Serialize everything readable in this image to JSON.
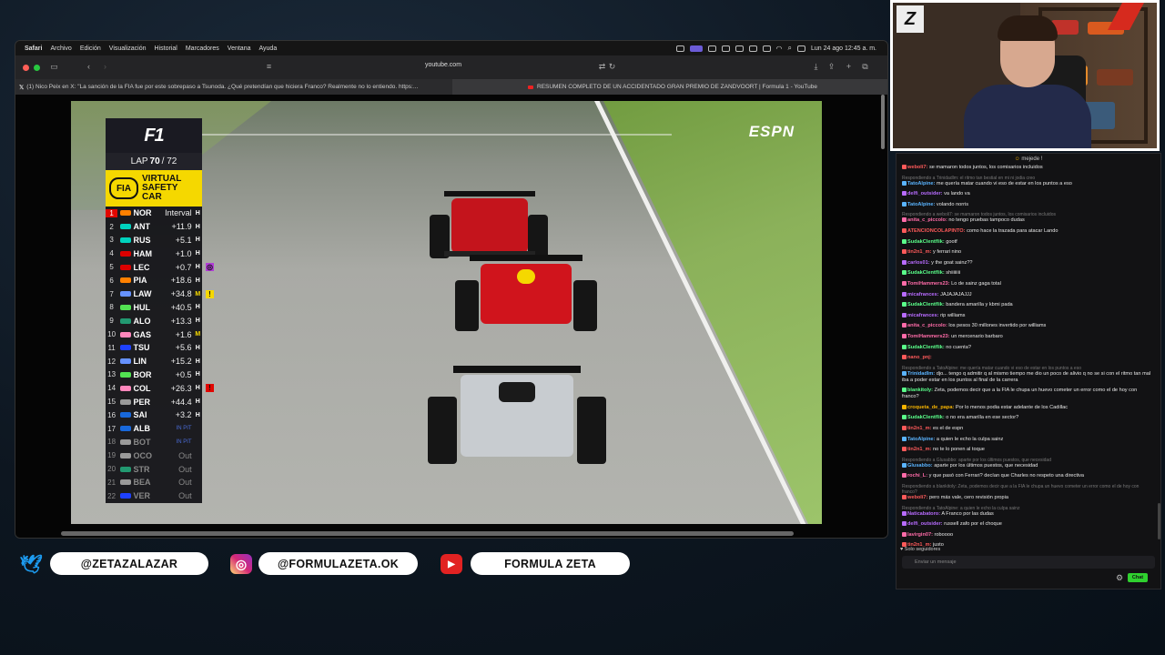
{
  "menubar": {
    "items": [
      "Safari",
      "Archivo",
      "Edición",
      "Visualización",
      "Historial",
      "Marcadores",
      "Ventana",
      "Ayuda"
    ],
    "datetime": "Lun 24 ago 12:45 a. m."
  },
  "toolbar": {
    "url": "youtube.com"
  },
  "tabs": [
    {
      "label": "(1) Nico Peix en X: \"La sanción de la FIA fue por este sobrepaso a Tsunoda. ¿Qué pretendían que hiciera Franco? Realmente no lo entiendo. https:..."
    },
    {
      "label": "RESUMEN COMPLETO DE UN ACCIDENTADO GRAN PREMIO DE ZANDVOORT | Formula 1 - YouTube"
    }
  ],
  "video": {
    "broadcaster": "ESPN",
    "tower": {
      "lap_label": "LAP",
      "lap_current": "70",
      "lap_total": "/ 72",
      "fia": "FIA",
      "vsc_line1": "VIRTUAL",
      "vsc_line2": "SAFETY",
      "vsc_line3": "CAR",
      "rows": [
        {
          "pos": "1",
          "driver": "NOR",
          "gap": "Interval",
          "tyre": "H",
          "tyre_color": "#ffffff",
          "team_color": "#ff8000"
        },
        {
          "pos": "2",
          "driver": "ANT",
          "gap": "+11.9",
          "tyre": "H",
          "tyre_color": "#ffffff",
          "team_color": "#00d2be"
        },
        {
          "pos": "3",
          "driver": "RUS",
          "gap": "+5.1",
          "tyre": "H",
          "tyre_color": "#ffffff",
          "team_color": "#00d2be"
        },
        {
          "pos": "4",
          "driver": "HAM",
          "gap": "+1.0",
          "tyre": "H",
          "tyre_color": "#ffffff",
          "team_color": "#dc0000"
        },
        {
          "pos": "5",
          "driver": "LEC",
          "gap": "+0.7",
          "tyre": "H",
          "tyre_color": "#ffffff",
          "team_color": "#dc0000",
          "flag": "◎",
          "flag_color": "#b13cd6"
        },
        {
          "pos": "6",
          "driver": "PIA",
          "gap": "+18.6",
          "tyre": "H",
          "tyre_color": "#ffffff",
          "team_color": "#ff8000"
        },
        {
          "pos": "7",
          "driver": "LAW",
          "gap": "+34.8",
          "tyre": "M",
          "tyre_color": "#f5d800",
          "team_color": "#6692ff",
          "flag": "!",
          "flag_color": "#f5d800"
        },
        {
          "pos": "8",
          "driver": "HUL",
          "gap": "+40.5",
          "tyre": "H",
          "tyre_color": "#ffffff",
          "team_color": "#52e252"
        },
        {
          "pos": "9",
          "driver": "ALO",
          "gap": "+13.3",
          "tyre": "H",
          "tyre_color": "#ffffff",
          "team_color": "#229971"
        },
        {
          "pos": "10",
          "driver": "GAS",
          "gap": "+1.6",
          "tyre": "M",
          "tyre_color": "#f5d800",
          "team_color": "#ff87bc"
        },
        {
          "pos": "11",
          "driver": "TSU",
          "gap": "+5.6",
          "tyre": "H",
          "tyre_color": "#ffffff",
          "team_color": "#1e41ff"
        },
        {
          "pos": "12",
          "driver": "LIN",
          "gap": "+15.2",
          "tyre": "H",
          "tyre_color": "#ffffff",
          "team_color": "#6692ff"
        },
        {
          "pos": "13",
          "driver": "BOR",
          "gap": "+0.5",
          "tyre": "H",
          "tyre_color": "#ffffff",
          "team_color": "#52e252"
        },
        {
          "pos": "14",
          "driver": "COL",
          "gap": "+26.3",
          "tyre": "H",
          "tyre_color": "#ffffff",
          "team_color": "#ff87bc",
          "flag": "!",
          "flag_color": "#e10600"
        },
        {
          "pos": "15",
          "driver": "PER",
          "gap": "+44.4",
          "tyre": "H",
          "tyre_color": "#ffffff",
          "team_color": "#9a9a9a"
        },
        {
          "pos": "16",
          "driver": "SAI",
          "gap": "+3.2",
          "tyre": "H",
          "tyre_color": "#ffffff",
          "team_color": "#1868db"
        },
        {
          "pos": "17",
          "driver": "ALB",
          "gap": "IN PIT",
          "tyre": "",
          "tyre_color": "#4a6bd6",
          "team_color": "#1868db",
          "pit": true
        },
        {
          "pos": "18",
          "driver": "BOT",
          "gap": "IN PIT",
          "tyre": "",
          "tyre_color": "#4a6bd6",
          "team_color": "#9a9a9a",
          "out": true,
          "pit": true
        },
        {
          "pos": "19",
          "driver": "OCO",
          "gap": "Out",
          "tyre": "",
          "tyre_color": "#888888",
          "team_color": "#9a9a9a",
          "out": true
        },
        {
          "pos": "20",
          "driver": "STR",
          "gap": "Out",
          "tyre": "",
          "tyre_color": "#888888",
          "team_color": "#229971",
          "out": true
        },
        {
          "pos": "21",
          "driver": "BEA",
          "gap": "Out",
          "tyre": "",
          "tyre_color": "#888888",
          "team_color": "#9a9a9a",
          "out": true
        },
        {
          "pos": "22",
          "driver": "VER",
          "gap": "Out",
          "tyre": "",
          "tyre_color": "#888888",
          "team_color": "#1e41ff",
          "out": true
        }
      ]
    }
  },
  "social": [
    {
      "network": "twitter-icon",
      "handle": "@ZETAZALAZAR",
      "color": "#1d9bf0"
    },
    {
      "network": "instagram-icon",
      "handle": "@FORMULAZETA.OK",
      "color": "#d62976"
    },
    {
      "network": "youtube-icon",
      "handle": "FORMULA ZETA",
      "color": "#e22222"
    }
  ],
  "chat": {
    "pinned": "mejede !",
    "follow_note": "Solo seguidores",
    "input_placeholder": "Enviar un mensaje",
    "send_label": "Chat",
    "messages": [
      {
        "user": "weboli7:",
        "text": "se mamaron todos juntos, los comisarios incluidos",
        "color": "#ff5a5a"
      },
      {
        "reply": "Respondiendo a Trinidadlm: el ritmo tan bestial en mi ni jodia creo",
        "user": "TatoAlpine:",
        "text": "me quería matar cuando vi eso de estar en los puntos a eso",
        "color": "#5ab4ff"
      },
      {
        "user": "delfi_outsider:",
        "text": "va lando va",
        "color": "#b86bff"
      },
      {
        "user": "TatoAlpine:",
        "text": "volando norris",
        "color": "#5ab4ff"
      },
      {
        "reply": "Respondiendo a weboli7: se mamaron todos juntos, los comisarios incluidos",
        "user": "anita_c_piccolo:",
        "text": "no tengo pruebas tampoco dudas",
        "color": "#ff6ba8"
      },
      {
        "user": "ATENCIONCOLAPINTO:",
        "text": "como hace la trazada para atacar Lando",
        "color": "#ff5a5a"
      },
      {
        "user": "SudakClentflik:",
        "text": "gootf",
        "color": "#5aff8a"
      },
      {
        "user": "tin2n1_m:",
        "text": "y ferrari nino",
        "color": "#ff5a5a"
      },
      {
        "user": "carlos01:",
        "text": "y the goat sainz??",
        "color": "#b86bff"
      },
      {
        "user": "SudakClentflik:",
        "text": "shiiiiiiii",
        "color": "#5aff8a"
      },
      {
        "user": "TomiHammers23:",
        "text": "Lo de sainz gaga total",
        "color": "#ff6ba8"
      },
      {
        "user": "micafrances:",
        "text": "JAJAJAJAJJJ",
        "color": "#b86bff"
      },
      {
        "user": "SudakClentflik:",
        "text": "bandera amarilla y kbmi pada",
        "color": "#5aff8a"
      },
      {
        "user": "micafrances:",
        "text": "rip williams",
        "color": "#b86bff"
      },
      {
        "user": "anita_c_piccolo:",
        "text": "los pesos 30 millones invertido por williams",
        "color": "#ff6ba8"
      },
      {
        "user": "TomiHammers23:",
        "text": "un mercenario barbaro",
        "color": "#ff6ba8"
      },
      {
        "user": "SudakClentflik:",
        "text": "no cuenta?",
        "color": "#5aff8a"
      },
      {
        "user": "nano_pnj:",
        "text": "",
        "color": "#ff5a5a"
      },
      {
        "reply": "Respondiendo a TatoAlpine: me quería matar cuando vi eso de estar en los puntos a eso",
        "user": "Trinidadlm:",
        "text": "djo... tengo q admitir q al mismo tiempo me dio un poco de alivio q no se si con el ritmo tan mal iba a poder estar en los puntos al final de la carrera",
        "color": "#5ab4ff"
      },
      {
        "user": "blankitoly:",
        "text": "Zeta, podemos decir que a la FIA le chupa un huevo cometer un error como el de hoy con franco?",
        "color": "#5aff8a"
      },
      {
        "user": "croqueta_de_papa:",
        "text": "Por lo menos podia estar adelante de los Cadillac",
        "color": "#f5b300"
      },
      {
        "user": "SudakClentflik:",
        "text": "o no era amarilla en ese sector?",
        "color": "#5aff8a"
      },
      {
        "user": "tin2n1_m:",
        "text": "es el de espn",
        "color": "#ff5a5a"
      },
      {
        "user": "TatoAlpine:",
        "text": "a quien le echo la culpa sainz",
        "color": "#5ab4ff"
      },
      {
        "user": "tin2n1_m:",
        "text": "no te lo ponen al toque",
        "color": "#ff5a5a"
      },
      {
        "reply": "Respondiendo a Glusabbo: aparte por los últimos puestos, que necesidad",
        "user": "Glusabbo:",
        "text": "aparte por los últimos puestos, que necesidad",
        "color": "#5ab4ff"
      },
      {
        "user": "rochi_L:",
        "text": "y que pasó con Ferrari? decían que Charles no respeto una directiva",
        "color": "#ff6ba8"
      },
      {
        "reply": "Respondiendo a blankitoly: Zeta, podemos decir que a la FIA le chupa un huevo cometer un error como el de hoy con franco?",
        "user": "weboli7:",
        "text": "pero más vale, cero revisión propia",
        "color": "#ff5a5a"
      },
      {
        "reply": "Respondiendo a TatoAlpine: a quien le echo la culpa sainz",
        "user": "Naticabatoro:",
        "text": "A Franco por las dudas",
        "color": "#b86bff"
      },
      {
        "user": "delfi_outsider:",
        "text": "russell zafo por el choque",
        "color": "#b86bff"
      },
      {
        "user": "lavirgin07:",
        "text": "roboooo",
        "color": "#ff6ba8"
      },
      {
        "user": "tin2n1_m:",
        "text": "justo",
        "color": "#ff5a5a"
      }
    ]
  },
  "webcam": {
    "logo": "Z"
  }
}
